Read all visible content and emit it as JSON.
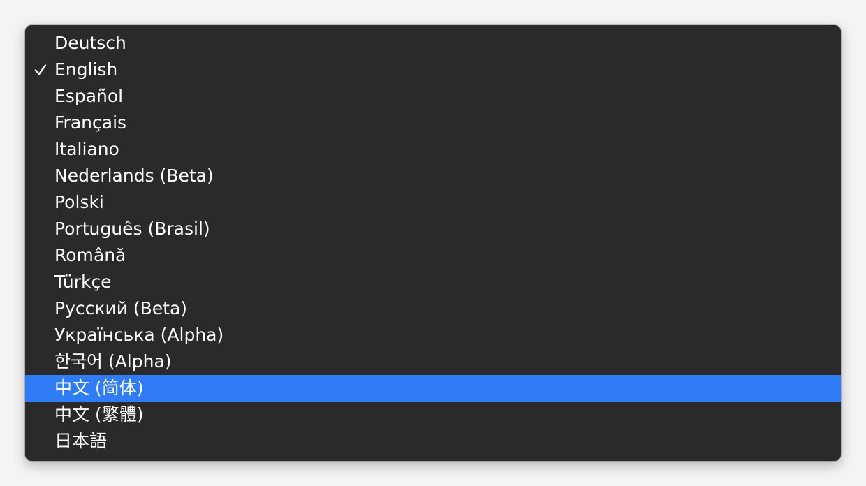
{
  "menu": {
    "selected_index": 1,
    "highlighted_index": 13,
    "items": [
      {
        "label": "Deutsch"
      },
      {
        "label": "English"
      },
      {
        "label": "Español"
      },
      {
        "label": "Français"
      },
      {
        "label": "Italiano"
      },
      {
        "label": "Nederlands (Beta)"
      },
      {
        "label": "Polski"
      },
      {
        "label": "Português (Brasil)"
      },
      {
        "label": "Română"
      },
      {
        "label": "Türkçe"
      },
      {
        "label": "Русский (Beta)"
      },
      {
        "label": "Українська (Alpha)"
      },
      {
        "label": "한국어 (Alpha)"
      },
      {
        "label": "中文 (简体)"
      },
      {
        "label": "中文 (繁體)"
      },
      {
        "label": "日本語"
      }
    ]
  },
  "colors": {
    "menu_background": "#2a2a2a",
    "highlight": "#2f7cf6",
    "text": "#ffffff"
  }
}
